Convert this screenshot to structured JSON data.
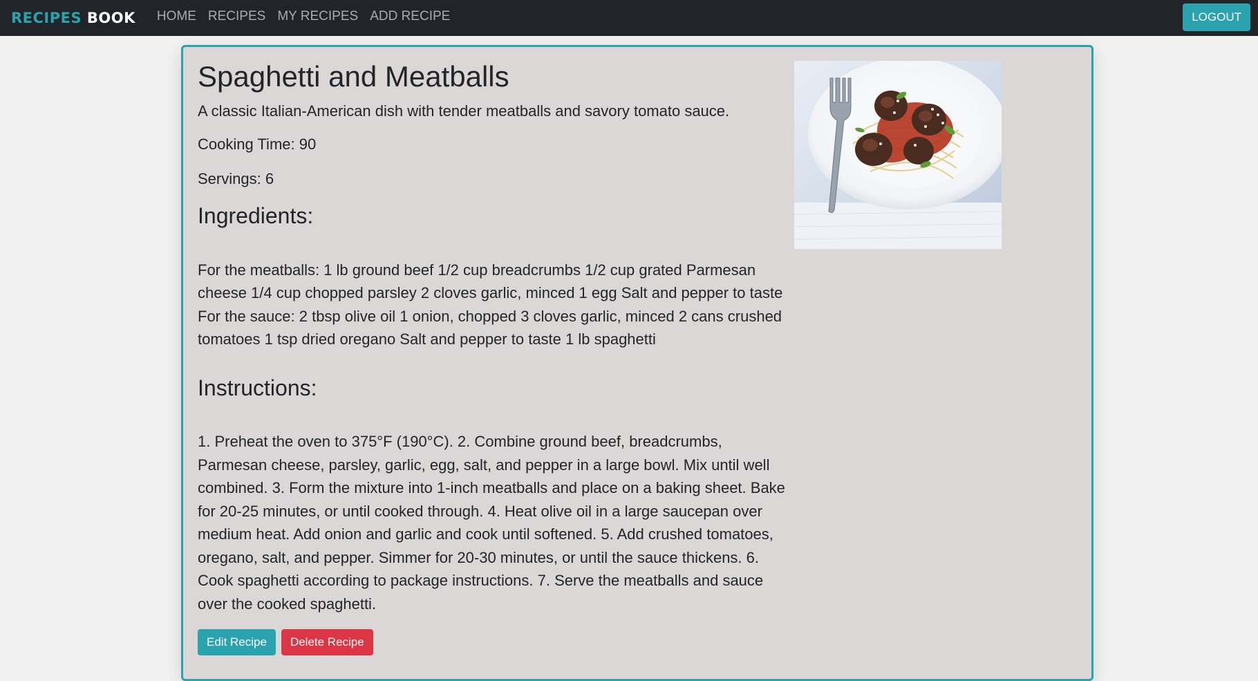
{
  "navbar": {
    "brand_part1": "RECIPES",
    "brand_part2": "BOOK",
    "links": [
      "HOME",
      "RECIPES",
      "MY RECIPES",
      "ADD RECIPE"
    ],
    "logout_label": "LOGOUT"
  },
  "recipe": {
    "title": "Spaghetti and Meatballs",
    "description": "A classic Italian-American dish with tender meatballs and savory tomato sauce.",
    "cooking_time": "Cooking Time: 90",
    "servings": "Servings: 6",
    "ingredients_heading": "Ingredients:",
    "ingredients": "For the meatballs: 1 lb ground beef 1/2 cup breadcrumbs 1/2 cup grated Parmesan cheese 1/4 cup chopped parsley 2 cloves garlic, minced 1 egg Salt and pepper to taste For the sauce: 2 tbsp olive oil 1 onion, chopped 3 cloves garlic, minced 2 cans crushed tomatoes 1 tsp dried oregano Salt and pepper to taste 1 lb spaghetti",
    "instructions_heading": "Instructions:",
    "instructions": "1. Preheat the oven to 375°F (190°C). 2. Combine ground beef, breadcrumbs, Parmesan cheese, parsley, garlic, egg, salt, and pepper in a large bowl. Mix until well combined. 3. Form the mixture into 1-inch meatballs and place on a baking sheet. Bake for 20-25 minutes, or until cooked through. 4. Heat olive oil in a large saucepan over medium heat. Add onion and garlic and cook until softened. 5. Add crushed tomatoes, oregano, salt, and pepper. Simmer for 20-30 minutes, or until the sauce thickens. 6. Cook spaghetti according to package instructions. 7. Serve the meatballs and sauce over the cooked spaghetti.",
    "edit_label": "Edit Recipe",
    "delete_label": "Delete Recipe"
  },
  "colors": {
    "accent": "#2aa3ae",
    "danger": "#dc3545",
    "navbar_bg": "#212529",
    "card_bg": "#dcd7d7"
  }
}
